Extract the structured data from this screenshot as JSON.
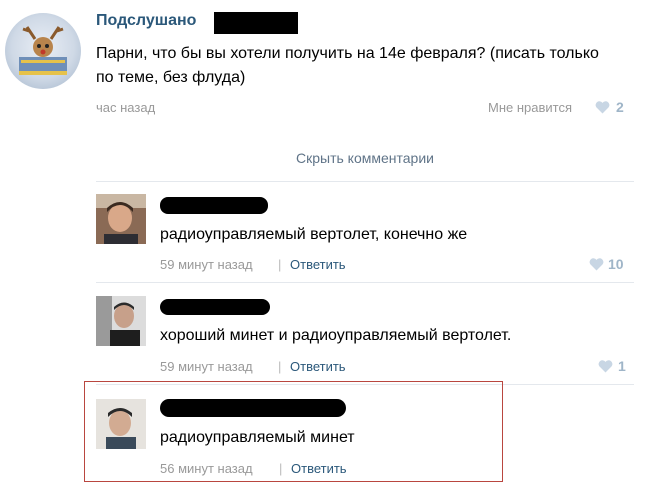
{
  "post": {
    "author": "Подслушано",
    "text": "Парни, что бы вы хотели получить на 14е февраля? (писать только по теме, без флуда)",
    "time": "час назад",
    "like_label": "Мне нравится",
    "like_count": "2"
  },
  "hide_comments": "Скрыть комментарии",
  "comments": [
    {
      "text": "радиоуправляемый вертолет, конечно же",
      "time": "59 минут назад",
      "separator": "|",
      "reply": "Ответить",
      "likes": "10"
    },
    {
      "text": "хороший минет и радиоуправляемый вертолет.",
      "time": "59 минут назад",
      "separator": "|",
      "reply": "Ответить",
      "likes": "1"
    },
    {
      "text": "радиоуправляемый минет",
      "time": "56 минут назад",
      "separator": "|",
      "reply": "Ответить",
      "likes": ""
    }
  ],
  "colors": {
    "link": "#2b587a",
    "muted": "#999999",
    "like": "#9fb5c8",
    "highlight": "#b9463f"
  },
  "icons": {
    "like": "heart-icon"
  }
}
